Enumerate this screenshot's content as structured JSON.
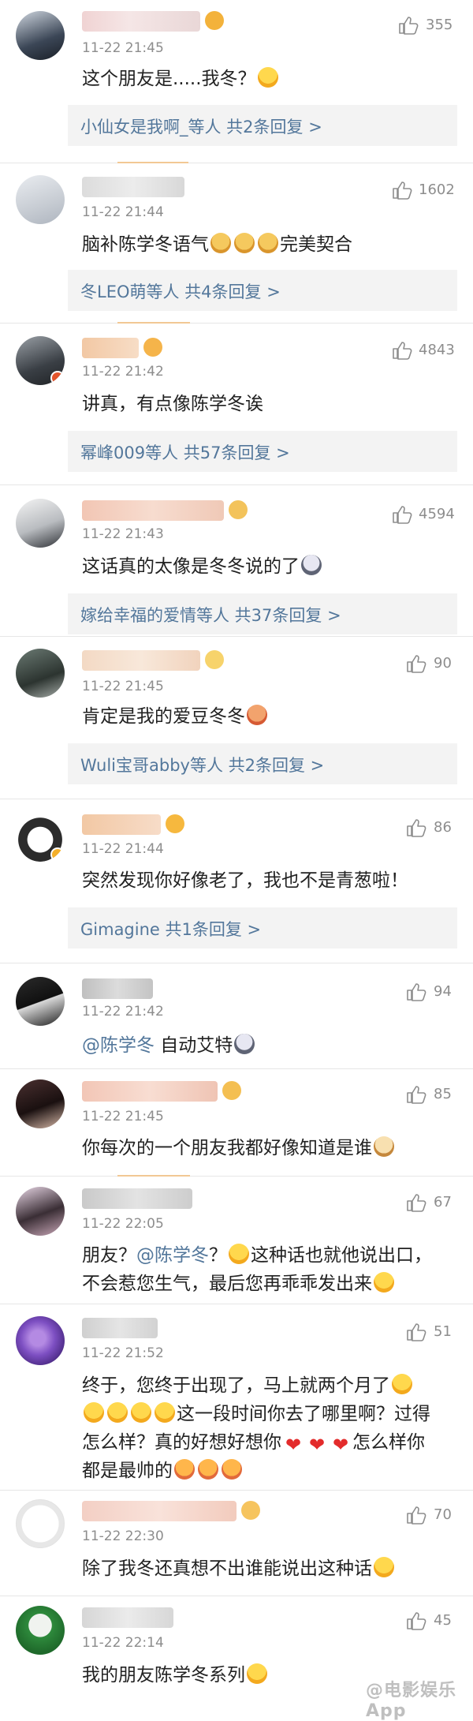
{
  "colors": {
    "link": "#53779b",
    "meta": "#8d8d8d",
    "reply_bg": "#f3f3f3",
    "heart": "#e32b2b"
  },
  "icons": {
    "like": "thumbs-up-outline-icon"
  },
  "comments": [
    {
      "time": "11-22 21:45",
      "likes": "355",
      "text": "这个朋友是.....我冬？",
      "reply": "小仙女是我啊_等人  共2条回复 >"
    },
    {
      "time": "11-22 21:44",
      "likes": "1602",
      "text_a": "脑补陈学冬语气",
      "text_b": "完美契合",
      "reply": "冬LEO萌等人  共4条回复 >"
    },
    {
      "time": "11-22 21:42",
      "likes": "4843",
      "text": "讲真，有点像陈学冬诶",
      "reply": "幂峰009等人  共57条回复 >"
    },
    {
      "time": "11-22 21:43",
      "likes": "4594",
      "text": "这话真的太像是冬冬说的了",
      "reply": "嫁给幸福的爱情等人  共37条回复 >"
    },
    {
      "time": "11-22 21:45",
      "likes": "90",
      "text": "肯定是我的爱豆冬冬",
      "reply": "Wuli宝哥abby等人  共2条回复 >"
    },
    {
      "time": "11-22 21:44",
      "likes": "86",
      "text": "突然发现你好像老了，我也不是青葱啦！",
      "reply": "Gimagine  共1条回复 >"
    },
    {
      "time": "11-22 21:42",
      "likes": "94",
      "text_a": "@陈学冬",
      "text_b": " 自动艾特"
    },
    {
      "time": "11-22 21:45",
      "likes": "85",
      "text": "你每次的一个朋友我都好像知道是谁"
    },
    {
      "time": "11-22 22:05",
      "likes": "67",
      "line1_a": "朋友？",
      "line1_mention": "@陈学冬",
      "line1_b": "？",
      "line1_c": "这种话也就他说出口，",
      "line2": "不会惹您生气，最后您再乖乖发出来"
    },
    {
      "time": "11-22 21:52",
      "likes": "51",
      "line1": "终于，您终于出现了，马上就两个月了",
      "line2": "这一段时间你去了哪里啊？过得",
      "line3_a": "怎么样？真的好想好想你",
      "line3_b": "怎么样你",
      "line4": "都是最帅的"
    },
    {
      "time": "11-22 22:30",
      "likes": "70",
      "text": "除了我冬还真想不出谁能说出这种话"
    },
    {
      "time": "11-22 22:14",
      "likes": "45",
      "text": "我的朋友陈学冬系列"
    }
  ],
  "watermark": "@电影娱乐App"
}
